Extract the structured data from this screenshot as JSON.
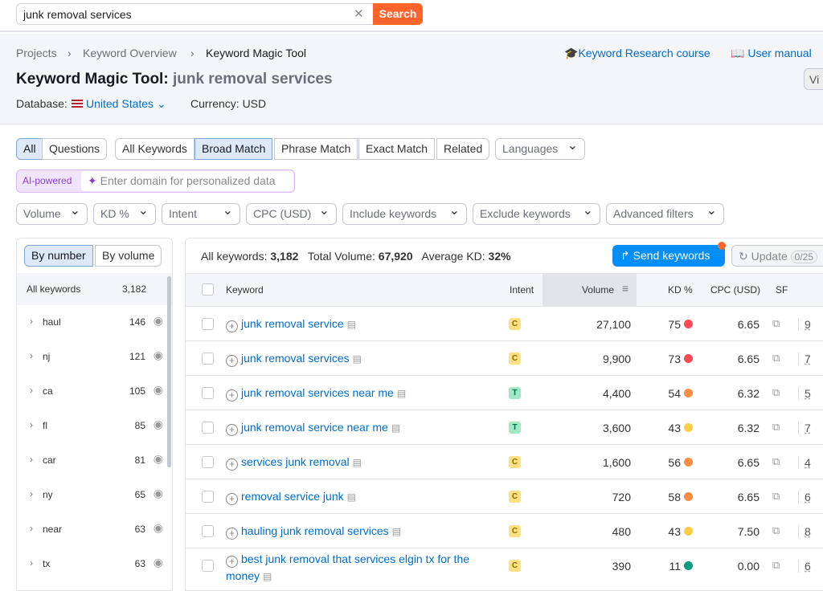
{
  "search": {
    "value": "junk removal services",
    "button": "Search"
  },
  "breadcrumb": [
    "Projects",
    "Keyword Overview",
    "Keyword Magic Tool"
  ],
  "links": {
    "course": "Keyword Research course",
    "manual": "User manual",
    "view": "Vi"
  },
  "title": {
    "tool": "Keyword Magic Tool:",
    "query": "junk removal services"
  },
  "database": {
    "label": "Database:",
    "value": "United States",
    "currency": "Currency: USD"
  },
  "tabs1": [
    "All",
    "Questions"
  ],
  "tabs2": [
    "All Keywords",
    "Broad Match",
    "Phrase Match",
    "Exact Match",
    "Related"
  ],
  "languages": "Languages",
  "ai": {
    "badge": "AI-powered",
    "placeholder": "Enter domain for personalized data"
  },
  "filters": [
    "Volume",
    "KD %",
    "Intent",
    "CPC (USD)",
    "Include keywords",
    "Exclude keywords",
    "Advanced filters"
  ],
  "left": {
    "by_number": "By number",
    "by_volume": "By volume",
    "all_label": "All keywords",
    "all_count": "3,182",
    "groups": [
      {
        "name": "haul",
        "count": "146"
      },
      {
        "name": "nj",
        "count": "121"
      },
      {
        "name": "ca",
        "count": "105"
      },
      {
        "name": "fl",
        "count": "85"
      },
      {
        "name": "car",
        "count": "81"
      },
      {
        "name": "ny",
        "count": "65"
      },
      {
        "name": "near",
        "count": "63"
      },
      {
        "name": "tx",
        "count": "63"
      }
    ]
  },
  "summary": {
    "all_label": "All keywords:",
    "all": "3,182",
    "vol_label": "Total Volume:",
    "vol": "67,920",
    "kd_label": "Average KD:",
    "kd": "32%"
  },
  "actions": {
    "send": "Send keywords",
    "update": "Update",
    "quota": "0/25"
  },
  "columns": [
    "Keyword",
    "Intent",
    "Volume",
    "KD %",
    "CPC (USD)",
    "SF"
  ],
  "colors": {
    "C": "#fce081",
    "T": "#a0e8c6",
    "red": "#ff4953",
    "orange": "#ff8c43",
    "yellow": "#ffcc47",
    "green": "#009f81"
  },
  "rows": [
    {
      "keyword": "junk removal service",
      "intent": "C",
      "volume": "27,100",
      "kd": "75",
      "kdc": "red",
      "cpc": "6.65",
      "sf": "9"
    },
    {
      "keyword": "junk removal services",
      "intent": "C",
      "volume": "9,900",
      "kd": "73",
      "kdc": "red",
      "cpc": "6.65",
      "sf": "7"
    },
    {
      "keyword": "junk removal services near me",
      "intent": "T",
      "volume": "4,400",
      "kd": "54",
      "kdc": "orange",
      "cpc": "6.32",
      "sf": "5"
    },
    {
      "keyword": "junk removal service near me",
      "intent": "T",
      "volume": "3,600",
      "kd": "43",
      "kdc": "yellow",
      "cpc": "6.32",
      "sf": "7"
    },
    {
      "keyword": "services junk removal",
      "intent": "C",
      "volume": "1,600",
      "kd": "56",
      "kdc": "orange",
      "cpc": "6.65",
      "sf": "4"
    },
    {
      "keyword": "removal service junk",
      "intent": "C",
      "volume": "720",
      "kd": "58",
      "kdc": "orange",
      "cpc": "6.65",
      "sf": "6"
    },
    {
      "keyword": "hauling junk removal services",
      "intent": "C",
      "volume": "480",
      "kd": "43",
      "kdc": "yellow",
      "cpc": "7.50",
      "sf": "8"
    },
    {
      "keyword": "best junk removal that services elgin tx for the money",
      "intent": "C",
      "volume": "390",
      "kd": "11",
      "kdc": "green",
      "cpc": "0.00",
      "sf": "6"
    }
  ]
}
